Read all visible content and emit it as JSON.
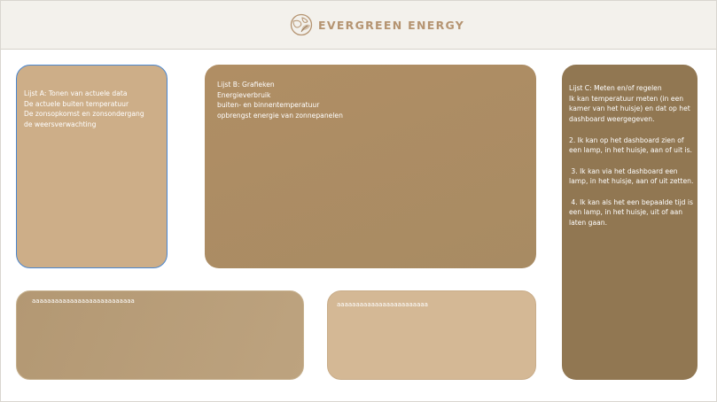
{
  "header": {
    "brand_name": "EVERGREEN ENERGY",
    "logo_icon": "evergreen-globe-leaf-logo"
  },
  "colors": {
    "header_bg": "#f3f1ec",
    "brand_text": "#b59471",
    "panel_a": "#cdae88",
    "panel_a_border": "#4a86cf",
    "panel_b": "#a88b63",
    "panel_c": "#917752",
    "panel_d": "#b39873",
    "panel_e": "#d4b895"
  },
  "panels": {
    "a": {
      "lines": [
        "Lijst A: Tonen van actuele data",
        "De actuele buiten temperatuur",
        "De zonsopkomst en zonsondergang",
        "de weersverwachting"
      ]
    },
    "b": {
      "lines": [
        "Lijst B: Grafieken",
        "Energieverbruik",
        "buiten- en binnentemperatuur",
        "opbrengst energie van zonnepanelen"
      ]
    },
    "c": {
      "lines": [
        "Lijst C: Meten en/of regelen",
        "Ik kan temperatuur meten (in een",
        "kamer van het huisje) en dat op het",
        "dashboard weergegeven.",
        "",
        "2. Ik kan op het dashboard zien of",
        "een lamp, in het huisje, aan of uit is.",
        "",
        " 3. Ik kan via het dashboard een",
        "lamp, in het huisje, aan of uit zetten.",
        "",
        " 4. Ik kan als het een bepaalde tijd is",
        "een lamp, in het huisje, uit of aan",
        "laten gaan."
      ]
    },
    "d": {
      "lines": [
        "aaaaaaaaaaaaaaaaaaaaaaaaaaa"
      ]
    },
    "e": {
      "lines": [
        "aaaaaaaaaaaaaaaaaaaaaaaa"
      ]
    }
  }
}
